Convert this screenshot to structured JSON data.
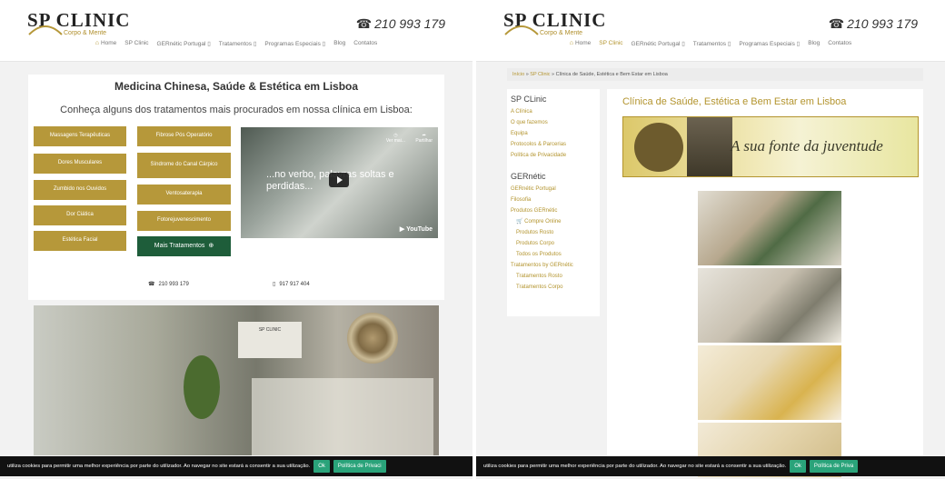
{
  "header": {
    "logo_title": "SP CLINIC",
    "logo_sub": "Corpo & Mente",
    "phone": "210 993 179"
  },
  "nav": {
    "items": [
      "Home",
      "SP Clinic",
      "GERnétic Portugal",
      "Tratamentos",
      "Programas Especiais",
      "Blog",
      "Contatos"
    ],
    "dropdown_marker": "▯",
    "active_right": "SP Clinic"
  },
  "left": {
    "heading": "Medicina Chinesa, Saúde & Estética em Lisboa",
    "subheading": "Conheça alguns dos tratamentos mais procurados em nossa clínica em Lisboa:",
    "treatments_col1": [
      "Massagens Terapêuticas",
      "Dores Musculares",
      "Zumbido nos Ouvidos",
      "Dor Ciática",
      "Estética Facial"
    ],
    "treatments_col2": [
      "Fibrose Pós Operatório",
      "Síndrome do Canal Cárpico",
      "Ventosaterapia",
      "Fotorejuvenescimento"
    ],
    "more_button": "Mais Tratamentos",
    "video_text": "...no verbo, palavras soltas e perdidas...",
    "video_watch_later": "Ver mai...",
    "video_share": "Partilhar",
    "video_brand": "YouTube",
    "phone_1": "210 993 179",
    "phone_2": "917 917 404",
    "photo_sign": "SP CLINIC"
  },
  "right": {
    "breadcrumb_home": "Início",
    "breadcrumb_sep": "»",
    "breadcrumb_section": "SP Clinic",
    "breadcrumb_current": "Clínica de Saúde, Estética e Bem Estar em Lisboa",
    "sidebar_title_1": "SP CLinic",
    "sidebar_links_1": [
      "A Clínica",
      "O que fazemos",
      "Equipa",
      "Protocolos & Parcerias",
      "Política de Privacidade"
    ],
    "sidebar_title_2": "GERnétic",
    "sidebar_links_2": [
      "GERnétic Portugal",
      "Filosofia",
      "Produtos GERnétic"
    ],
    "sidebar_sublinks_2": [
      "🛒 Compre Online",
      "Produtos Rosto",
      "Produtos Corpo",
      "Todos os Produtos"
    ],
    "sidebar_link_3": "Tratamentos by GERnétic",
    "sidebar_sublinks_3": [
      "Tratamentos Rosto",
      "Tratamentos Corpo"
    ],
    "page_title": "Clínica de Saúde, Estética e Bem Estar em Lisboa",
    "banner_text": "A sua fonte da juventude"
  },
  "cookie": {
    "left_text": "utiliza cookies para permitir uma melhor experiência por parte do utilizador. Ao navegar no site estará a consentir a sua utilização.",
    "ok_label": "Ok",
    "policy_label": "Política de Privaci",
    "policy_label_right": "Política de Priva"
  },
  "colors": {
    "gold": "#b6983a",
    "dark_green": "#1e5d3a",
    "cookie_button": "#2aa37a"
  }
}
